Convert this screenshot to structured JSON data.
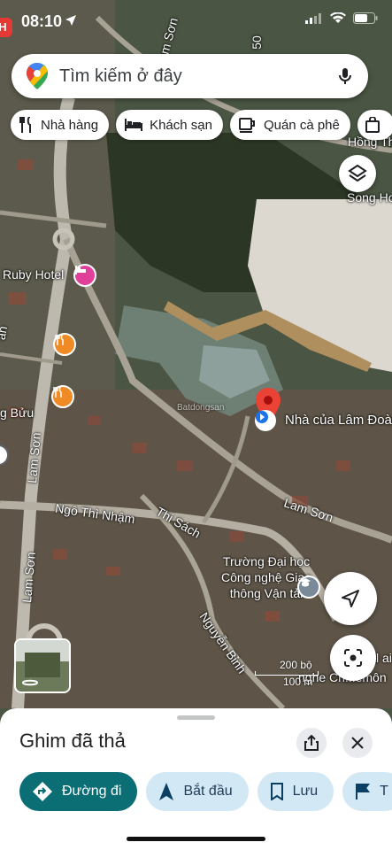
{
  "status_bar": {
    "time": "08:10"
  },
  "search": {
    "placeholder": "Tìm kiếm ở đây"
  },
  "chips": [
    {
      "label": "Nhà hàng",
      "icon": "fork-knife-icon"
    },
    {
      "label": "Khách sạn",
      "icon": "bed-icon"
    },
    {
      "label": "Quán cà phê",
      "icon": "coffee-icon"
    }
  ],
  "map_labels": {
    "ruby_hotel": "Ruby Hotel",
    "place_name": "Nhà của Lâm Đoàn",
    "lam_son_1": "Lam Sơn",
    "lam_son_2": "Lam Sơn",
    "lam_son_3": "Lam Sơn",
    "lam_son_top": "Lam Sơn",
    "ngo_thi_nham": "Ngô Thì Nhậm",
    "thi_sach": "Thi Sách",
    "nguyen_binh": "Nguyễn Bỉnh",
    "university": "Trường Đại học Công nghệ Giao thông Vận tải",
    "song_ho": "Song Ho",
    "hong_th": "Hồng Th",
    "g_buu": "g Bửu",
    "kl_label": "kl ai h",
    "chemon": "nghe Ch...emôn",
    "watermark": "Batdongsan",
    "road_50": "50"
  },
  "scale": {
    "top": "200 bộ",
    "bottom": "100 m"
  },
  "bottom_sheet": {
    "title": "Ghim đã thả",
    "actions": [
      {
        "label": "Đường đi",
        "icon": "directions-icon"
      },
      {
        "label": "Bắt đầu",
        "icon": "navigation-arrow-icon"
      },
      {
        "label": "Lưu",
        "icon": "bookmark-icon"
      },
      {
        "label": "T",
        "icon": "flag-icon"
      }
    ]
  },
  "colors": {
    "primary_action": "#0b6e74",
    "secondary_action": "#d3e8f5",
    "pin": "#ea4335"
  }
}
